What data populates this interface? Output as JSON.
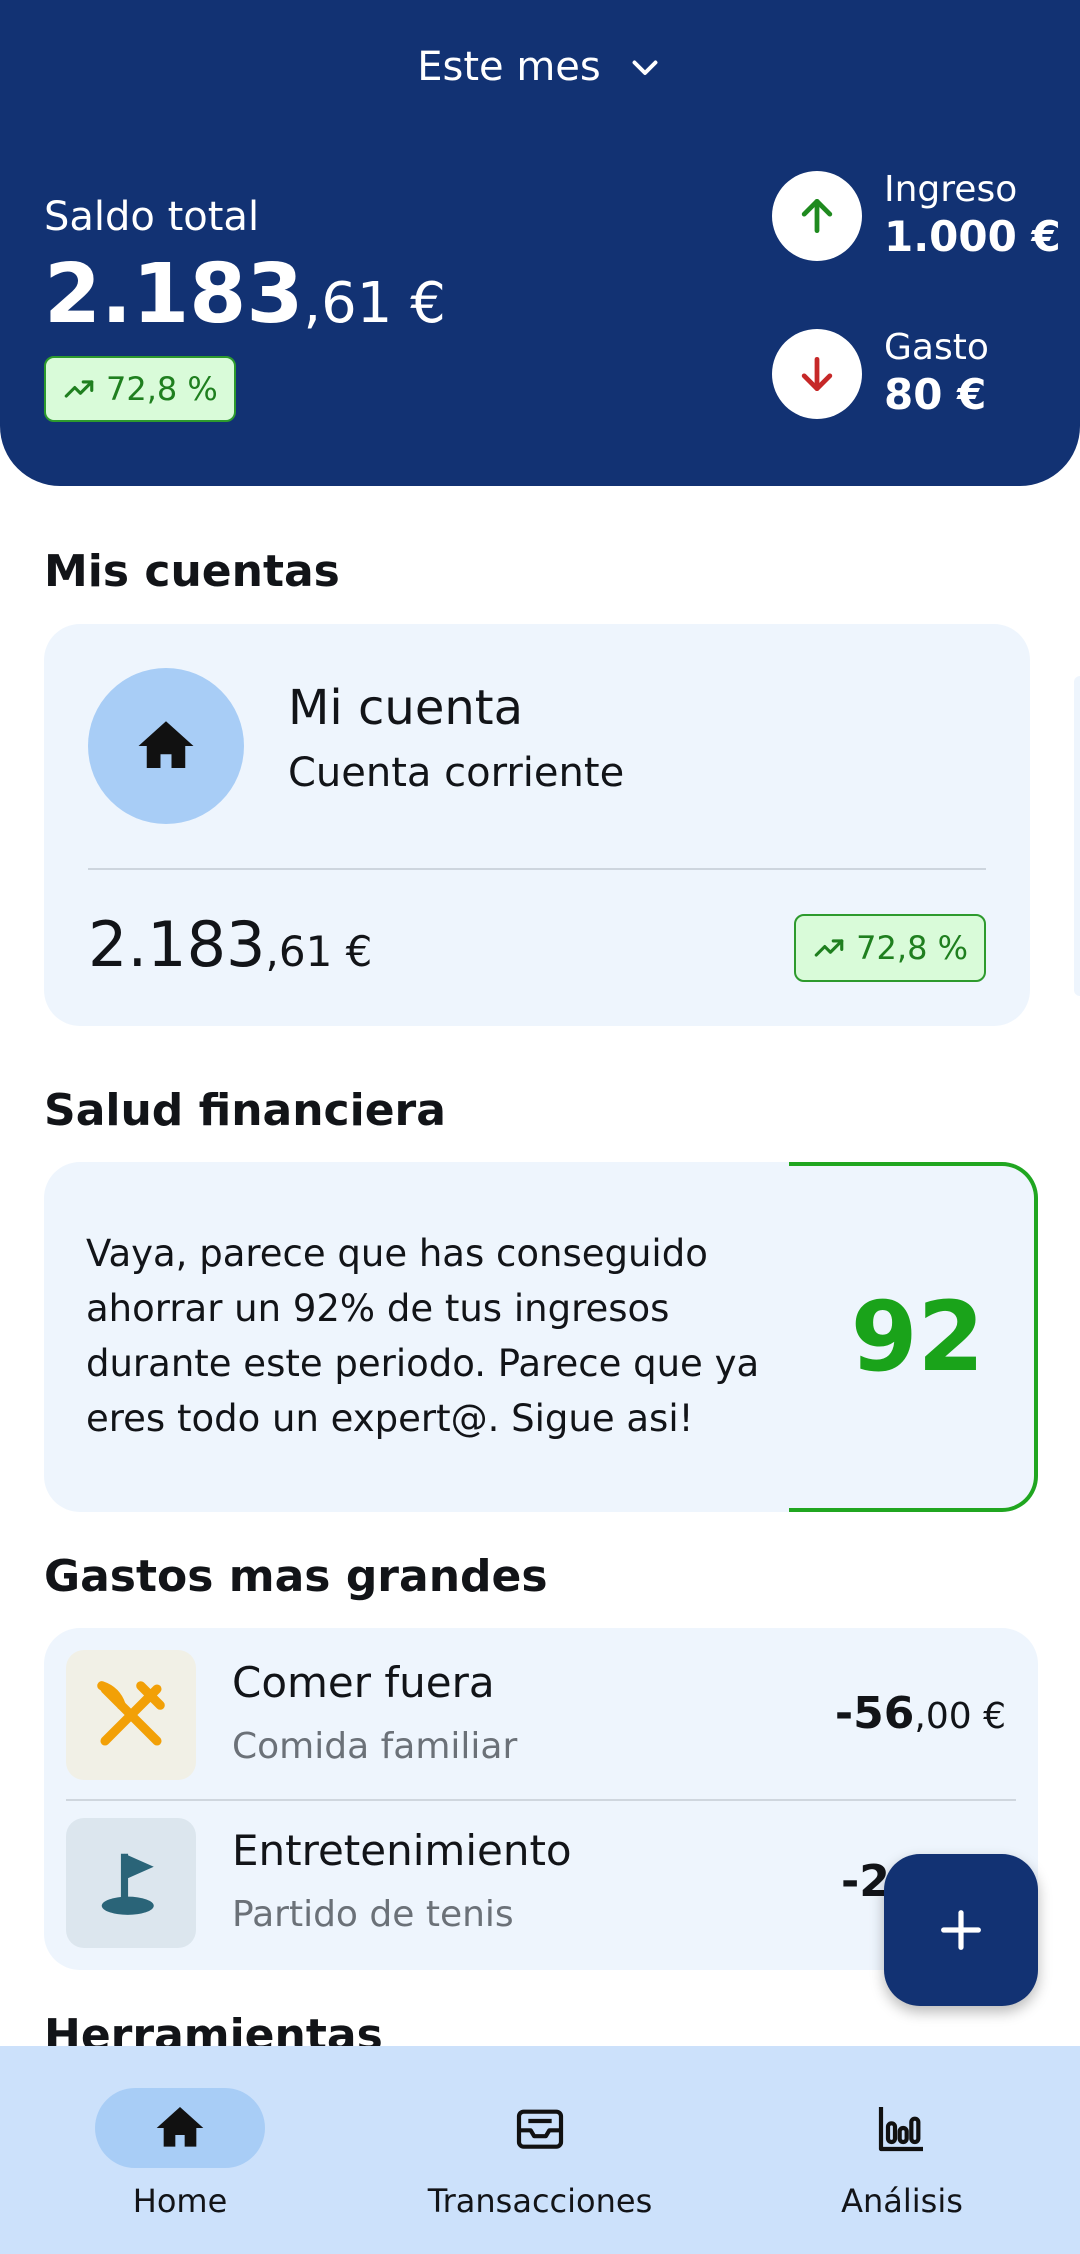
{
  "header": {
    "period_label": "Este mes",
    "balance_label": "Saldo total",
    "balance_int": "2.183",
    "balance_cents": ",61 €",
    "balance_change": "72,8 %",
    "income_label": "Ingreso",
    "income_value": "1.000 €",
    "expense_label": "Gasto",
    "expense_value": "80 €"
  },
  "accounts": {
    "title": "Mis cuentas",
    "items": [
      {
        "name": "Mi cuenta",
        "type": "Cuenta corriente",
        "amount_int": "2.183",
        "amount_cents": ",61 €",
        "change": "72,8 %",
        "icon": "home-icon"
      }
    ]
  },
  "health": {
    "title": "Salud financiera",
    "message": "Vaya, parece que has conseguido ahorrar un 92% de tus ingresos durante este periodo. Parece que ya eres todo un expert@. Sigue asi!",
    "score": "92"
  },
  "expenses": {
    "title": "Gastos mas grandes",
    "items": [
      {
        "title": "Comer fuera",
        "subtitle": "Comida familiar",
        "amount_int": "-56",
        "amount_cents": ",00 €",
        "icon": "utensils-icon",
        "icon_bg": "#f1f0e6",
        "icon_color": "#f2a007"
      },
      {
        "title": "Entretenimiento",
        "subtitle": "Partido de tenis",
        "amount_int": "-2",
        "amount_cents": "",
        "icon": "golf-flag-icon",
        "icon_bg": "#dce6ee",
        "icon_color": "#2a6478"
      }
    ]
  },
  "tools": {
    "title": "Herramientas"
  },
  "nav": {
    "home": "Home",
    "transactions": "Transacciones",
    "analysis": "Análisis"
  },
  "colors": {
    "primary": "#123273",
    "card_bg": "#eef5fd",
    "positive": "#1aa31a",
    "negative": "#c62828",
    "nav_bg": "#cce1fb"
  }
}
